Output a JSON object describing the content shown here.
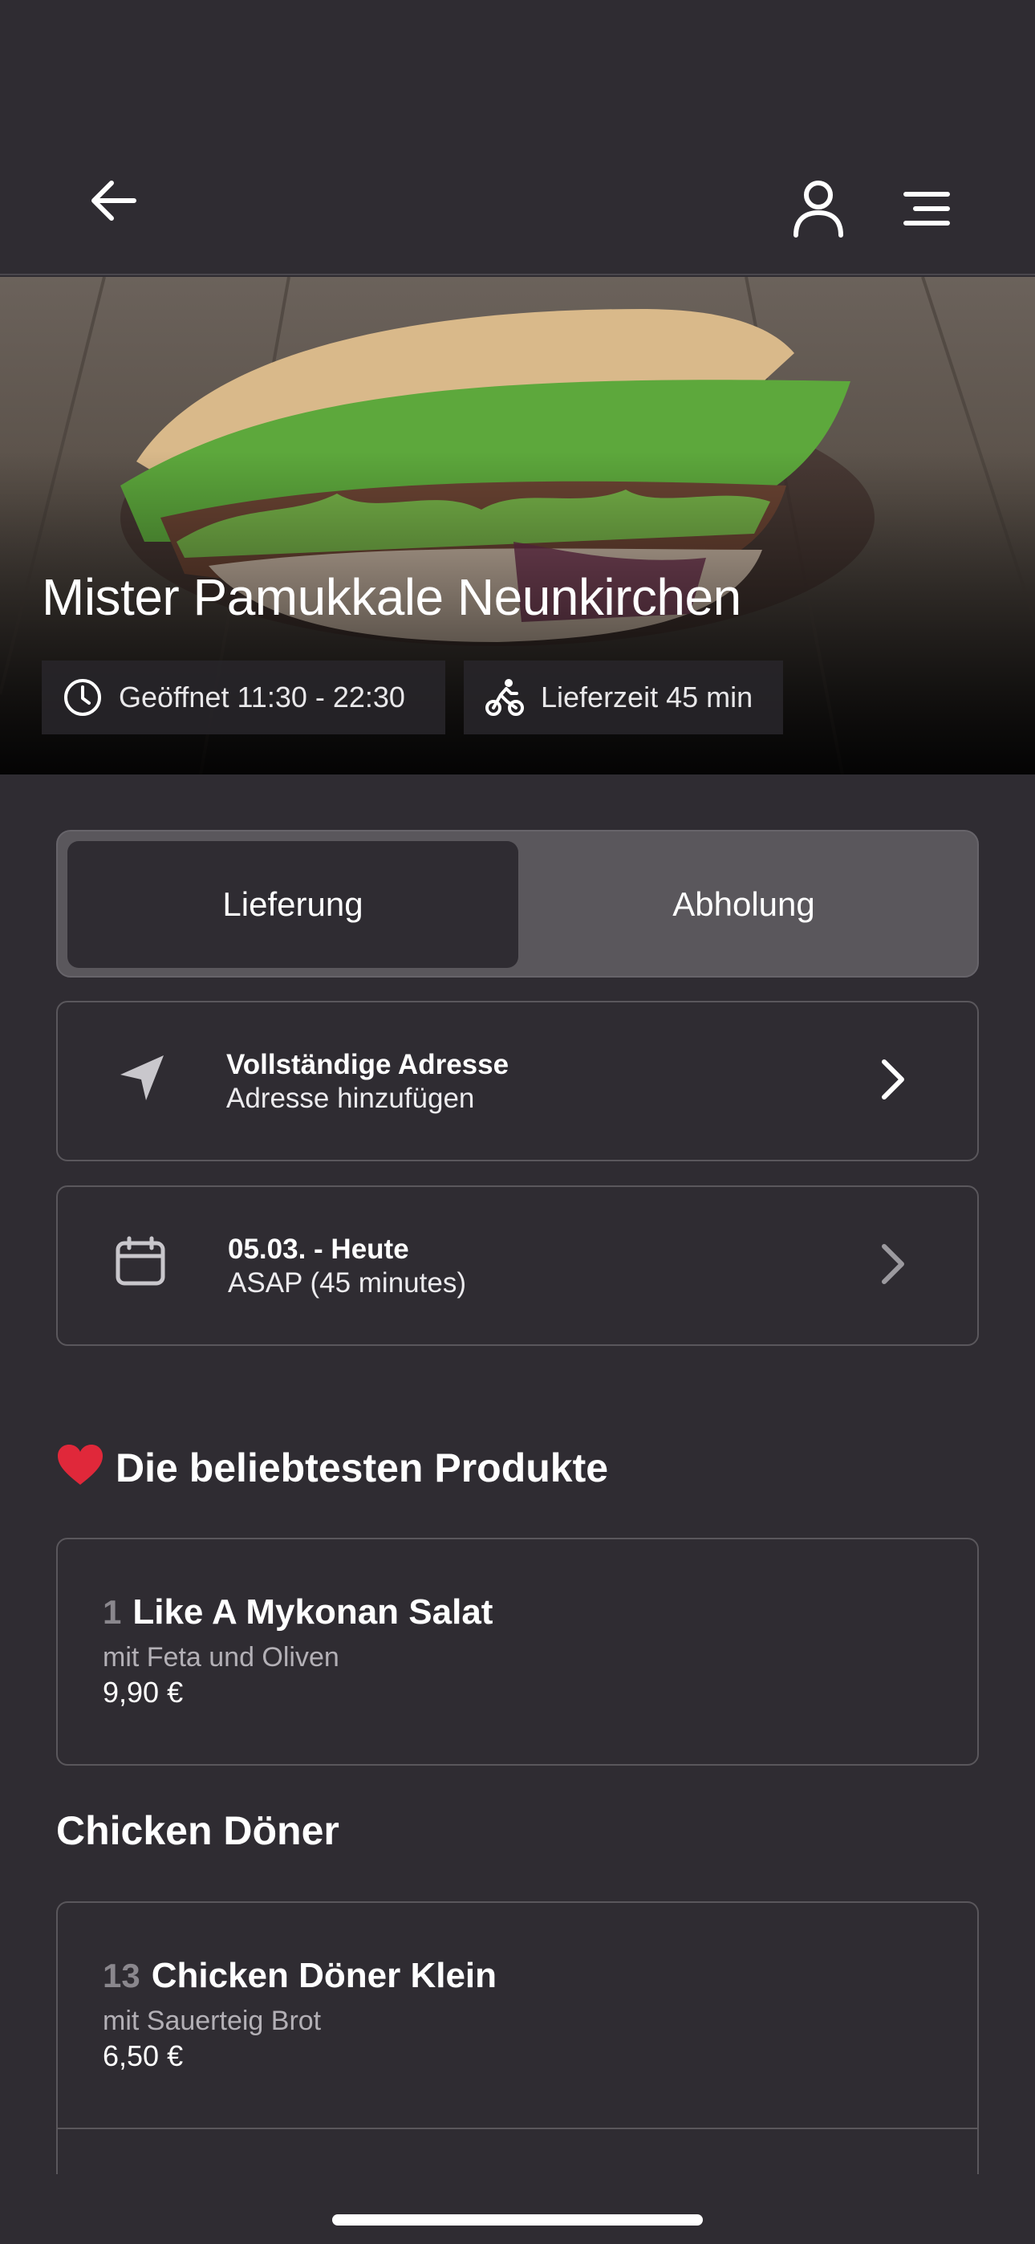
{
  "header": {
    "back_icon": "arrow-left-icon",
    "user_icon": "user-icon",
    "menu_icon": "menu-icon"
  },
  "restaurant": {
    "name": "Mister Pamukkale Neunkirchen",
    "opening_hours": "Geöffnet 11:30 - 22:30",
    "delivery_time": "Lieferzeit 45 min"
  },
  "order_mode": {
    "options": [
      "Lieferung",
      "Abholung"
    ],
    "selected": "Lieferung"
  },
  "address": {
    "title": "Vollständige Adresse",
    "subtitle": "Adresse hinzufügen"
  },
  "schedule": {
    "title": "05.03. - Heute",
    "subtitle": "ASAP (45 minutes)"
  },
  "popular": {
    "title": "Die beliebtesten Produkte",
    "emoji": "❤️",
    "items": [
      {
        "number": "1",
        "name": "Like A Mykonan Salat",
        "description": "mit Feta und Oliven",
        "price": "9,90 €"
      }
    ]
  },
  "categories": [
    {
      "title": "Chicken Döner",
      "items": [
        {
          "number": "13",
          "name": "Chicken Döner Klein",
          "description": "mit Sauerteig Brot",
          "price": "6,50 €"
        }
      ]
    }
  ],
  "colors": {
    "background": "#2f2c32",
    "segment_bg": "#5a575c",
    "border": "#5a575c",
    "muted_text": "#b3b0b6"
  }
}
